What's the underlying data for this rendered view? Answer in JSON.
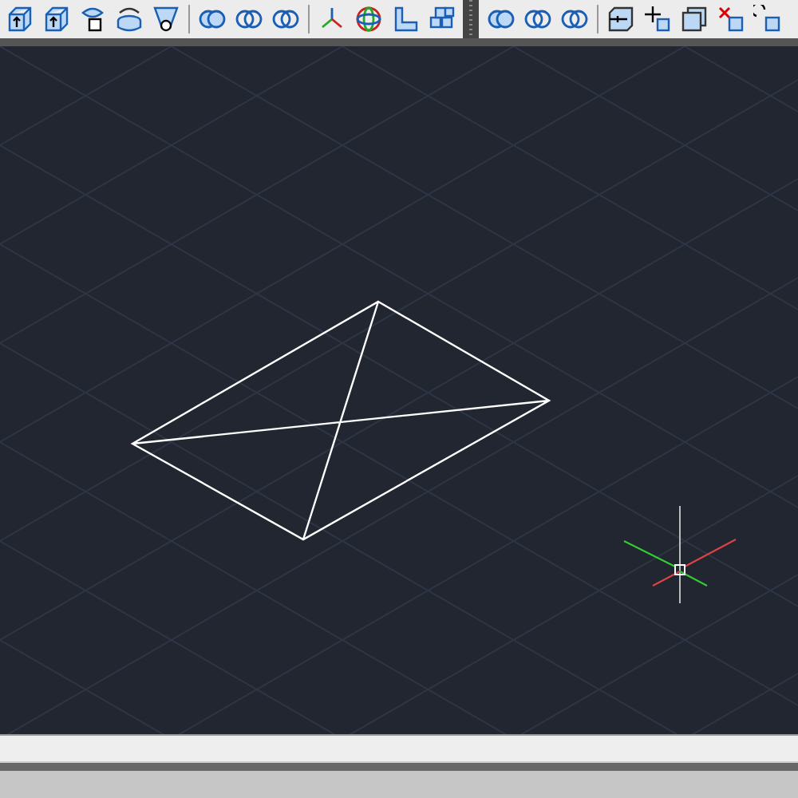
{
  "toolbars": [
    {
      "buttons": [
        {
          "kind": "extrude"
        },
        {
          "kind": "presspull"
        },
        {
          "kind": "sweep"
        },
        {
          "kind": "revolve"
        },
        {
          "kind": "loft"
        }
      ]
    },
    {
      "buttons": [
        {
          "kind": "union"
        },
        {
          "kind": "subtract"
        },
        {
          "kind": "intersect"
        }
      ]
    },
    {
      "buttons": [
        {
          "kind": "axes"
        },
        {
          "kind": "orbit"
        },
        {
          "kind": "section"
        },
        {
          "kind": "array"
        }
      ]
    },
    {
      "buttons": [
        {
          "kind": "union"
        },
        {
          "kind": "subtract"
        },
        {
          "kind": "intersect"
        }
      ],
      "grip": true
    },
    {
      "buttons": [
        {
          "kind": "slice"
        },
        {
          "kind": "move"
        },
        {
          "kind": "shell"
        },
        {
          "kind": "delete"
        },
        {
          "kind": "rotate"
        }
      ]
    }
  ]
}
